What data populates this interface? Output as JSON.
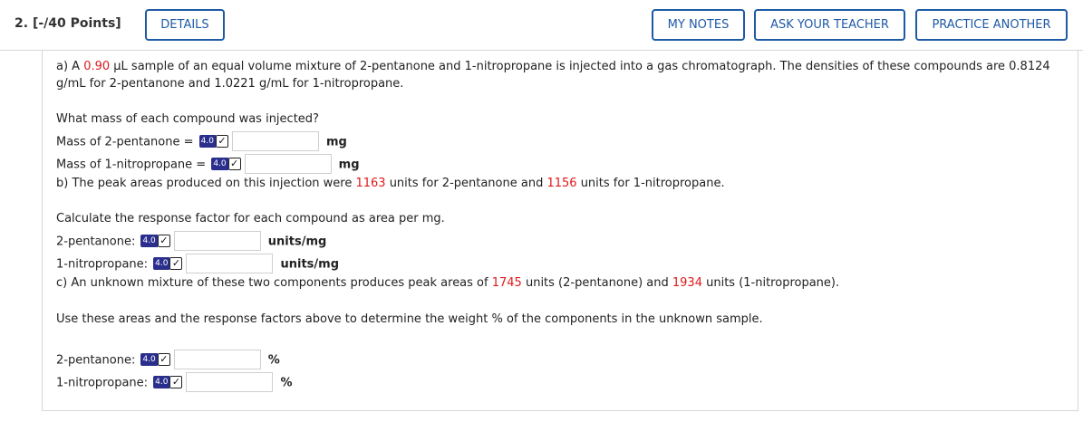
{
  "header": {
    "question_number": "2.",
    "points": "[-/40 Points]",
    "details_label": "DETAILS",
    "my_notes_label": "MY NOTES",
    "ask_teacher_label": "ASK YOUR TEACHER",
    "practice_another_label": "PRACTICE ANOTHER"
  },
  "colors": {
    "accent": "#1f5aa6",
    "highlight": "#e0191c",
    "badge": "#2a2f8e"
  },
  "badge": {
    "sigfig": "4.0",
    "check": "✓"
  },
  "part_a": {
    "text_1": "a) A ",
    "volume": "0.90",
    "text_2": " µL sample of an equal volume mixture of 2-pentanone and 1-nitropropane is injected into a gas chromatograph. The densities of these compounds are 0.8124",
    "text_3": "g/mL for 2-pentanone and 1.0221 g/mL for 1-nitropropane.",
    "prompt": "What mass of each compound was injected?",
    "rows": [
      {
        "label": "Mass of 2-pentanone = ",
        "unit": "mg",
        "value": ""
      },
      {
        "label": "Mass of 1-nitropropane = ",
        "unit": "mg",
        "value": ""
      }
    ]
  },
  "part_b": {
    "text_1": "b) The peak areas produced on this injection were ",
    "area_1": "1163",
    "text_2": " units for 2-pentanone and ",
    "area_2": "1156",
    "text_3": " units for 1-nitropropane.",
    "prompt": "Calculate the response factor for each compound as area per mg.",
    "rows": [
      {
        "label": "2-pentanone: ",
        "unit": "units/mg",
        "value": ""
      },
      {
        "label": "1-nitropropane: ",
        "unit": "units/mg",
        "value": ""
      }
    ]
  },
  "part_c": {
    "text_1": "c) An unknown mixture of these two components produces peak areas of ",
    "area_1": "1745",
    "text_2": " units (2-pentanone) and ",
    "area_2": "1934",
    "text_3": " units (1-nitropropane).",
    "prompt": "Use these areas and the response factors above to determine the weight % of the components in the unknown sample.",
    "rows": [
      {
        "label": "2-pentanone: ",
        "unit": "%",
        "value": ""
      },
      {
        "label": "1-nitropropane: ",
        "unit": "%",
        "value": ""
      }
    ]
  }
}
